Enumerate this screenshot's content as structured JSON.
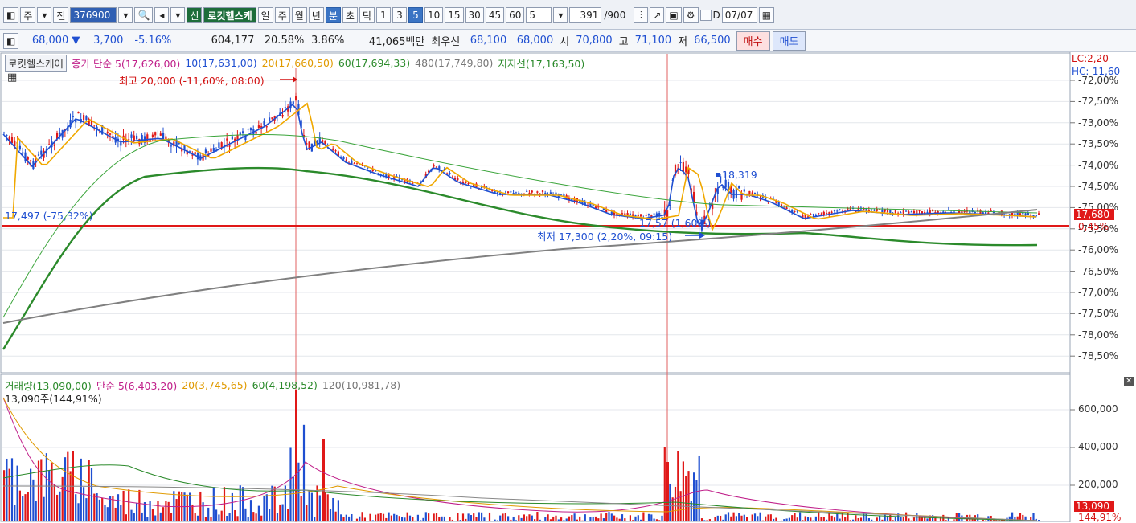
{
  "toolbar": {
    "items": [
      "주",
      "전",
      "일",
      "주",
      "월",
      "년",
      "분",
      "초",
      "틱",
      "1",
      "3",
      "5",
      "10",
      "15",
      "30",
      "45",
      "60",
      "5"
    ],
    "code": "376900",
    "name": "로킷헬스케",
    "count": "391",
    "count_total": "/900",
    "checkbox_label": "D",
    "date": "07/07",
    "active_interval": "5",
    "active_unit": "분"
  },
  "quote": {
    "price": "68,000",
    "change": "3,700",
    "change_pct": "-5.16%",
    "volume": "604,177",
    "turnover_rate": "20.58%",
    "ratio": "3.86%",
    "amount": "41,065백만",
    "best_bid_label": "최우선",
    "best_bid": "68,100",
    "best_ask": "68,000",
    "open_label": "시",
    "open": "70,800",
    "high_label": "고",
    "high": "71,100",
    "low_label": "저",
    "low": "66,500",
    "buy_label": "매수",
    "sell_label": "매도"
  },
  "price_panel": {
    "name_box": "로킷헬스케어",
    "legend_main": "종가 단순 5(17,626,00)",
    "legend_10": "10(17,631,00)",
    "legend_20": "20(17,660,50)",
    "legend_60": "60(17,694,33)",
    "legend_480": "480(17,749,80)",
    "legend_support": "지지선(17,163,50)",
    "lc": "LC:2,20",
    "hc": "HC:-11,60",
    "high_ann": "최고 20,000 (-11,60%, 08:00)",
    "low_ann": "최저 17,300 (2,20%, 09:15)",
    "left_level": "17,497 (-75,32%)",
    "mid_marker": "18,319",
    "mid_ann": "17,57 (1,60%)",
    "current_tag": "17,680",
    "current_pct": "0,45%",
    "y_ticks": [
      "-72,00%",
      "-72,50%",
      "-73,00%",
      "-73,50%",
      "-74,00%",
      "-74,50%",
      "-75,00%",
      "-75,50%",
      "-76,00%",
      "-76,50%",
      "-77,00%",
      "-77,50%",
      "-78,00%",
      "-78,50%"
    ]
  },
  "volume_panel": {
    "legend_main": "거래량(13,090,00)",
    "legend_5": "단순 5(6,403,20)",
    "legend_20": "20(3,745,65)",
    "legend_60": "60(4,198,52)",
    "legend_120": "120(10,981,78)",
    "info": "13,090주(144,91%)",
    "y_ticks": [
      "600,000",
      "400,000",
      "200,000"
    ],
    "current_tag": "13,090",
    "current_pct": "144,91%"
  },
  "colors": {
    "up": "#e01818",
    "down": "#1f4fd1",
    "ma5": "#1f4fd1",
    "ma20": "#f0a800",
    "ma60": "#2b8a2b",
    "ma480": "#808080",
    "support": "#e01818"
  }
}
